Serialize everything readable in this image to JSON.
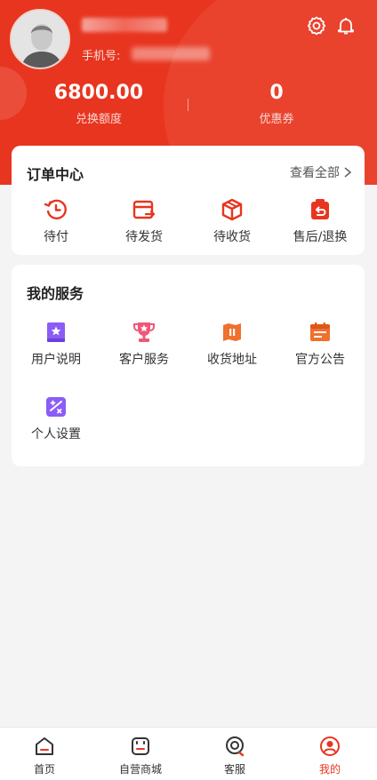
{
  "colors": {
    "brand": "#e8351f",
    "purple": "#8b5cf6",
    "pink": "#f0577a",
    "orange": "#f0702d"
  },
  "profile": {
    "phone_label": "手机号:"
  },
  "stats": [
    {
      "value": "6800.00",
      "label": "兑换额度"
    },
    {
      "value": "0",
      "label": "优惠券"
    }
  ],
  "orders": {
    "title": "订单中心",
    "view_all": "查看全部",
    "items": [
      {
        "label": "待付",
        "icon": "clock-refresh-icon"
      },
      {
        "label": "待发货",
        "icon": "wallet-arrow-icon"
      },
      {
        "label": "待收货",
        "icon": "package-box-icon"
      },
      {
        "label": "售后/退换",
        "icon": "return-bag-icon"
      }
    ]
  },
  "services": {
    "title": "我的服务",
    "items": [
      {
        "label": "用户说明",
        "icon": "star-book-icon"
      },
      {
        "label": "客户服务",
        "icon": "trophy-icon"
      },
      {
        "label": "收货地址",
        "icon": "map-icon"
      },
      {
        "label": "官方公告",
        "icon": "calendar-icon"
      },
      {
        "label": "个人设置",
        "icon": "percent-icon"
      }
    ]
  },
  "tabbar": [
    {
      "label": "首页",
      "icon": "home-icon",
      "active": false
    },
    {
      "label": "自营商城",
      "icon": "shop-bag-icon",
      "active": false
    },
    {
      "label": "客服",
      "icon": "service-icon",
      "active": false
    },
    {
      "label": "我的",
      "icon": "user-icon",
      "active": true
    }
  ]
}
